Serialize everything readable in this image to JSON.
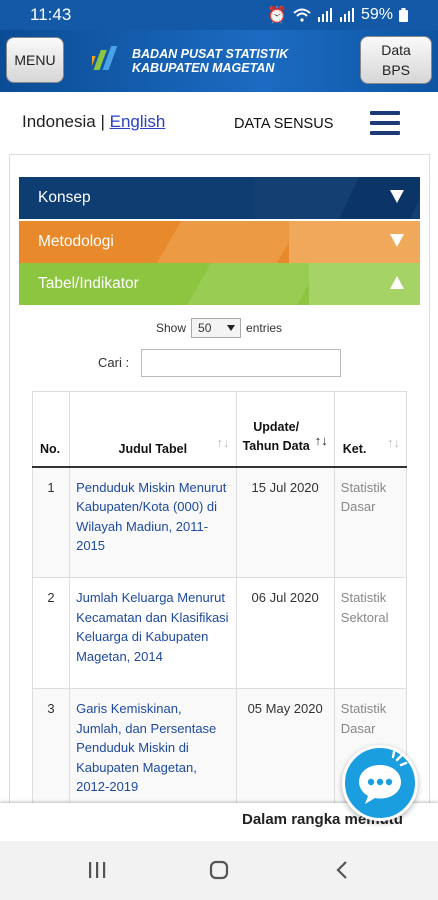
{
  "status": {
    "time": "11:43",
    "battery": "59%"
  },
  "header": {
    "menu_label": "MENU",
    "logo_line1": "BADAN PUSAT STATISTIK",
    "logo_line2": "KABUPATEN MAGETAN",
    "data_label_1": "Data",
    "data_label_2": "BPS"
  },
  "lang": {
    "indonesia": "Indonesia",
    "sep": " | ",
    "english": "English"
  },
  "nav": {
    "sensus": "DATA SENSUS"
  },
  "accordion": [
    {
      "label": "Konsep",
      "state": "collapsed"
    },
    {
      "label": "Metodologi",
      "state": "collapsed"
    },
    {
      "label": "Tabel/Indikator",
      "state": "expanded"
    }
  ],
  "datatable": {
    "show_label": "Show",
    "show_value": "50",
    "entries_label": "entries",
    "search_label": "Cari :",
    "search_value": "",
    "columns": [
      "No.",
      "Judul Tabel",
      "Update/ Tahun Data",
      "Ket."
    ],
    "rows": [
      {
        "no": "1",
        "judul": "Penduduk Miskin Menurut Kabupaten/Kota (000) di Wilayah Madiun, 2011-2015",
        "update": "15 Jul 2020",
        "ket": "Statistik Dasar"
      },
      {
        "no": "2",
        "judul": "Jumlah Keluarga Menurut Kecamatan dan Klasifikasi Keluarga di Kabupaten Magetan, 2014",
        "update": "06 Jul 2020",
        "ket": "Statistik Sektoral"
      },
      {
        "no": "3",
        "judul": "Garis Kemiskinan, Jumlah, dan Persentase Penduduk Miskin di Kabupaten Magetan, 2012-2019",
        "update": "05 May 2020",
        "ket": "Statistik Dasar"
      }
    ]
  },
  "marquee": {
    "text": "Dalam rangka memutu"
  },
  "colors": {
    "konsep": "#0e3d72",
    "metodologi": "#e88a2b",
    "tabel": "#8cc540",
    "header": "#1459a8"
  }
}
